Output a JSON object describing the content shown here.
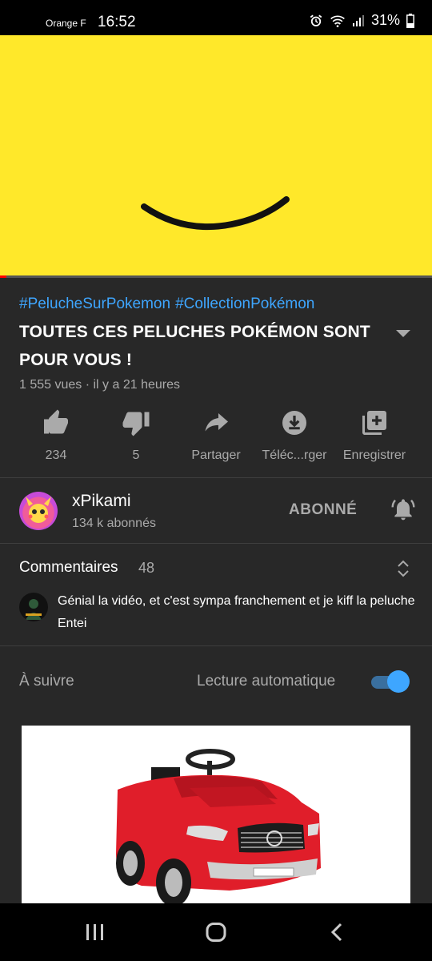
{
  "status_bar": {
    "carrier": "Orange F",
    "time": "16:52",
    "battery": "31%",
    "icons": [
      "alarm-icon",
      "wifi-icon",
      "signal-icon",
      "battery-icon"
    ]
  },
  "player": {
    "progress_fraction": 0.015,
    "background_color": "#ffe82a"
  },
  "video": {
    "hashtags": [
      "#PelucheSurPokemon",
      "#CollectionPokémon"
    ],
    "title": "TOUTES CES PELUCHES POKÉMON SONT POUR VOUS !",
    "meta": "1 555 vues · il y a 21 heures"
  },
  "actions": [
    {
      "icon": "like-icon",
      "label": "234"
    },
    {
      "icon": "dislike-icon",
      "label": "5"
    },
    {
      "icon": "share-icon",
      "label": "Partager"
    },
    {
      "icon": "download-icon",
      "label": "Téléc...rger"
    },
    {
      "icon": "save-playlist-icon",
      "label": "Enregistrer"
    }
  ],
  "channel": {
    "name": "xPikami",
    "subscribers": "134 k abonnés",
    "subscribe_state": "ABONNÉ"
  },
  "comments": {
    "heading": "Commentaires",
    "count": "48",
    "top_comment": "Génial la vidéo, et c'est sympa franchement et je kiff la peluche Entei"
  },
  "up_next": {
    "label": "À suivre",
    "autoplay_label": "Lecture automatique",
    "autoplay_on": true
  },
  "colors": {
    "accent": "#3ea6ff",
    "background": "#282828",
    "progress": "#ff0000"
  }
}
